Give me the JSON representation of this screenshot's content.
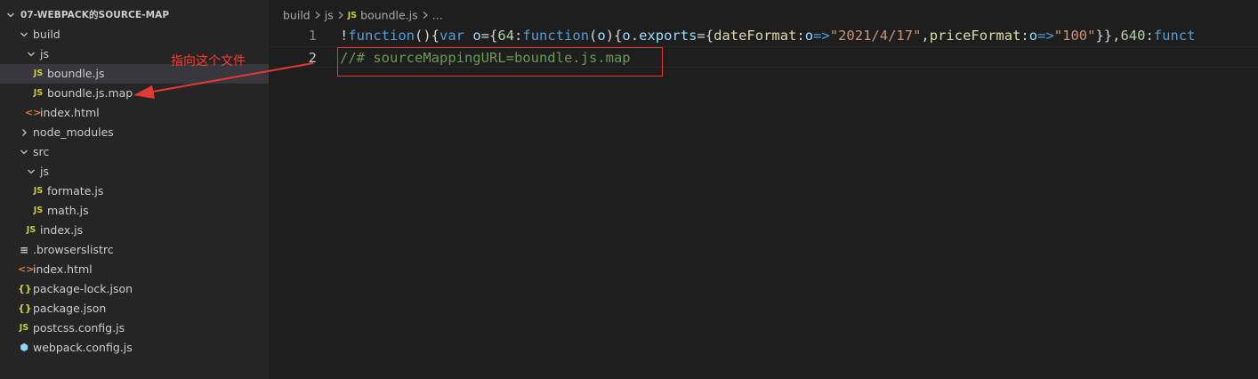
{
  "explorer": {
    "root": "07-WEBPACK的SOURCE-MAP",
    "items": [
      {
        "label": "build",
        "type": "folder",
        "open": true,
        "depth": 1
      },
      {
        "label": "js",
        "type": "folder",
        "open": true,
        "depth": 2
      },
      {
        "label": "boundle.js",
        "type": "js",
        "depth": 3,
        "selected": true
      },
      {
        "label": "boundle.js.map",
        "type": "js",
        "depth": 3
      },
      {
        "label": "index.html",
        "type": "html",
        "depth": 2
      },
      {
        "label": "node_modules",
        "type": "folder",
        "open": false,
        "depth": 1
      },
      {
        "label": "src",
        "type": "folder",
        "open": true,
        "depth": 1
      },
      {
        "label": "js",
        "type": "folder",
        "open": true,
        "depth": 2
      },
      {
        "label": "formate.js",
        "type": "js",
        "depth": 3
      },
      {
        "label": "math.js",
        "type": "js",
        "depth": 3
      },
      {
        "label": "index.js",
        "type": "js",
        "depth": 2
      },
      {
        "label": ".browserslistrc",
        "type": "rc",
        "depth": 1
      },
      {
        "label": "index.html",
        "type": "html",
        "depth": 1
      },
      {
        "label": "package-lock.json",
        "type": "json",
        "depth": 1
      },
      {
        "label": "package.json",
        "type": "json",
        "depth": 1
      },
      {
        "label": "postcss.config.js",
        "type": "js",
        "depth": 1
      },
      {
        "label": "webpack.config.js",
        "type": "webpack",
        "depth": 1
      }
    ]
  },
  "icons": {
    "js": "JS",
    "html": "<>",
    "json": "{}",
    "rc": "≡",
    "webpack": "⬢"
  },
  "breadcrumb": {
    "part1": "build",
    "part2": "js",
    "file": "boundle.js",
    "ellipsis": "..."
  },
  "editor": {
    "line_numbers": [
      "1",
      "2"
    ],
    "line1_tokens": [
      {
        "t": "!",
        "c": "punc"
      },
      {
        "t": "function",
        "c": "kw"
      },
      {
        "t": "(){",
        "c": "punc"
      },
      {
        "t": "var",
        "c": "kw"
      },
      {
        "t": " ",
        "c": "punc"
      },
      {
        "t": "o",
        "c": "var"
      },
      {
        "t": "={",
        "c": "punc"
      },
      {
        "t": "64",
        "c": "num"
      },
      {
        "t": ":",
        "c": "punc"
      },
      {
        "t": "function",
        "c": "kw"
      },
      {
        "t": "(",
        "c": "punc"
      },
      {
        "t": "o",
        "c": "var"
      },
      {
        "t": "){",
        "c": "punc"
      },
      {
        "t": "o",
        "c": "var"
      },
      {
        "t": ".",
        "c": "punc"
      },
      {
        "t": "exports",
        "c": "var"
      },
      {
        "t": "={",
        "c": "punc"
      },
      {
        "t": "dateFormat",
        "c": "fn"
      },
      {
        "t": ":",
        "c": "punc"
      },
      {
        "t": "o",
        "c": "var"
      },
      {
        "t": "=>",
        "c": "kw"
      },
      {
        "t": "\"2021/4/17\"",
        "c": "str"
      },
      {
        "t": ",",
        "c": "punc"
      },
      {
        "t": "priceFormat",
        "c": "fn"
      },
      {
        "t": ":",
        "c": "punc"
      },
      {
        "t": "o",
        "c": "var"
      },
      {
        "t": "=>",
        "c": "kw"
      },
      {
        "t": "\"100\"",
        "c": "str"
      },
      {
        "t": "}},",
        "c": "punc"
      },
      {
        "t": "640",
        "c": "num"
      },
      {
        "t": ":",
        "c": "punc"
      },
      {
        "t": "funct",
        "c": "kw"
      }
    ],
    "line2_text": "//# sourceMappingURL=boundle.js.map"
  },
  "annotation": {
    "label": "指向这个文件"
  },
  "colors": {
    "annotation": "#ff3b30",
    "selection": "#37373d",
    "js_icon": "#cbcb41"
  }
}
